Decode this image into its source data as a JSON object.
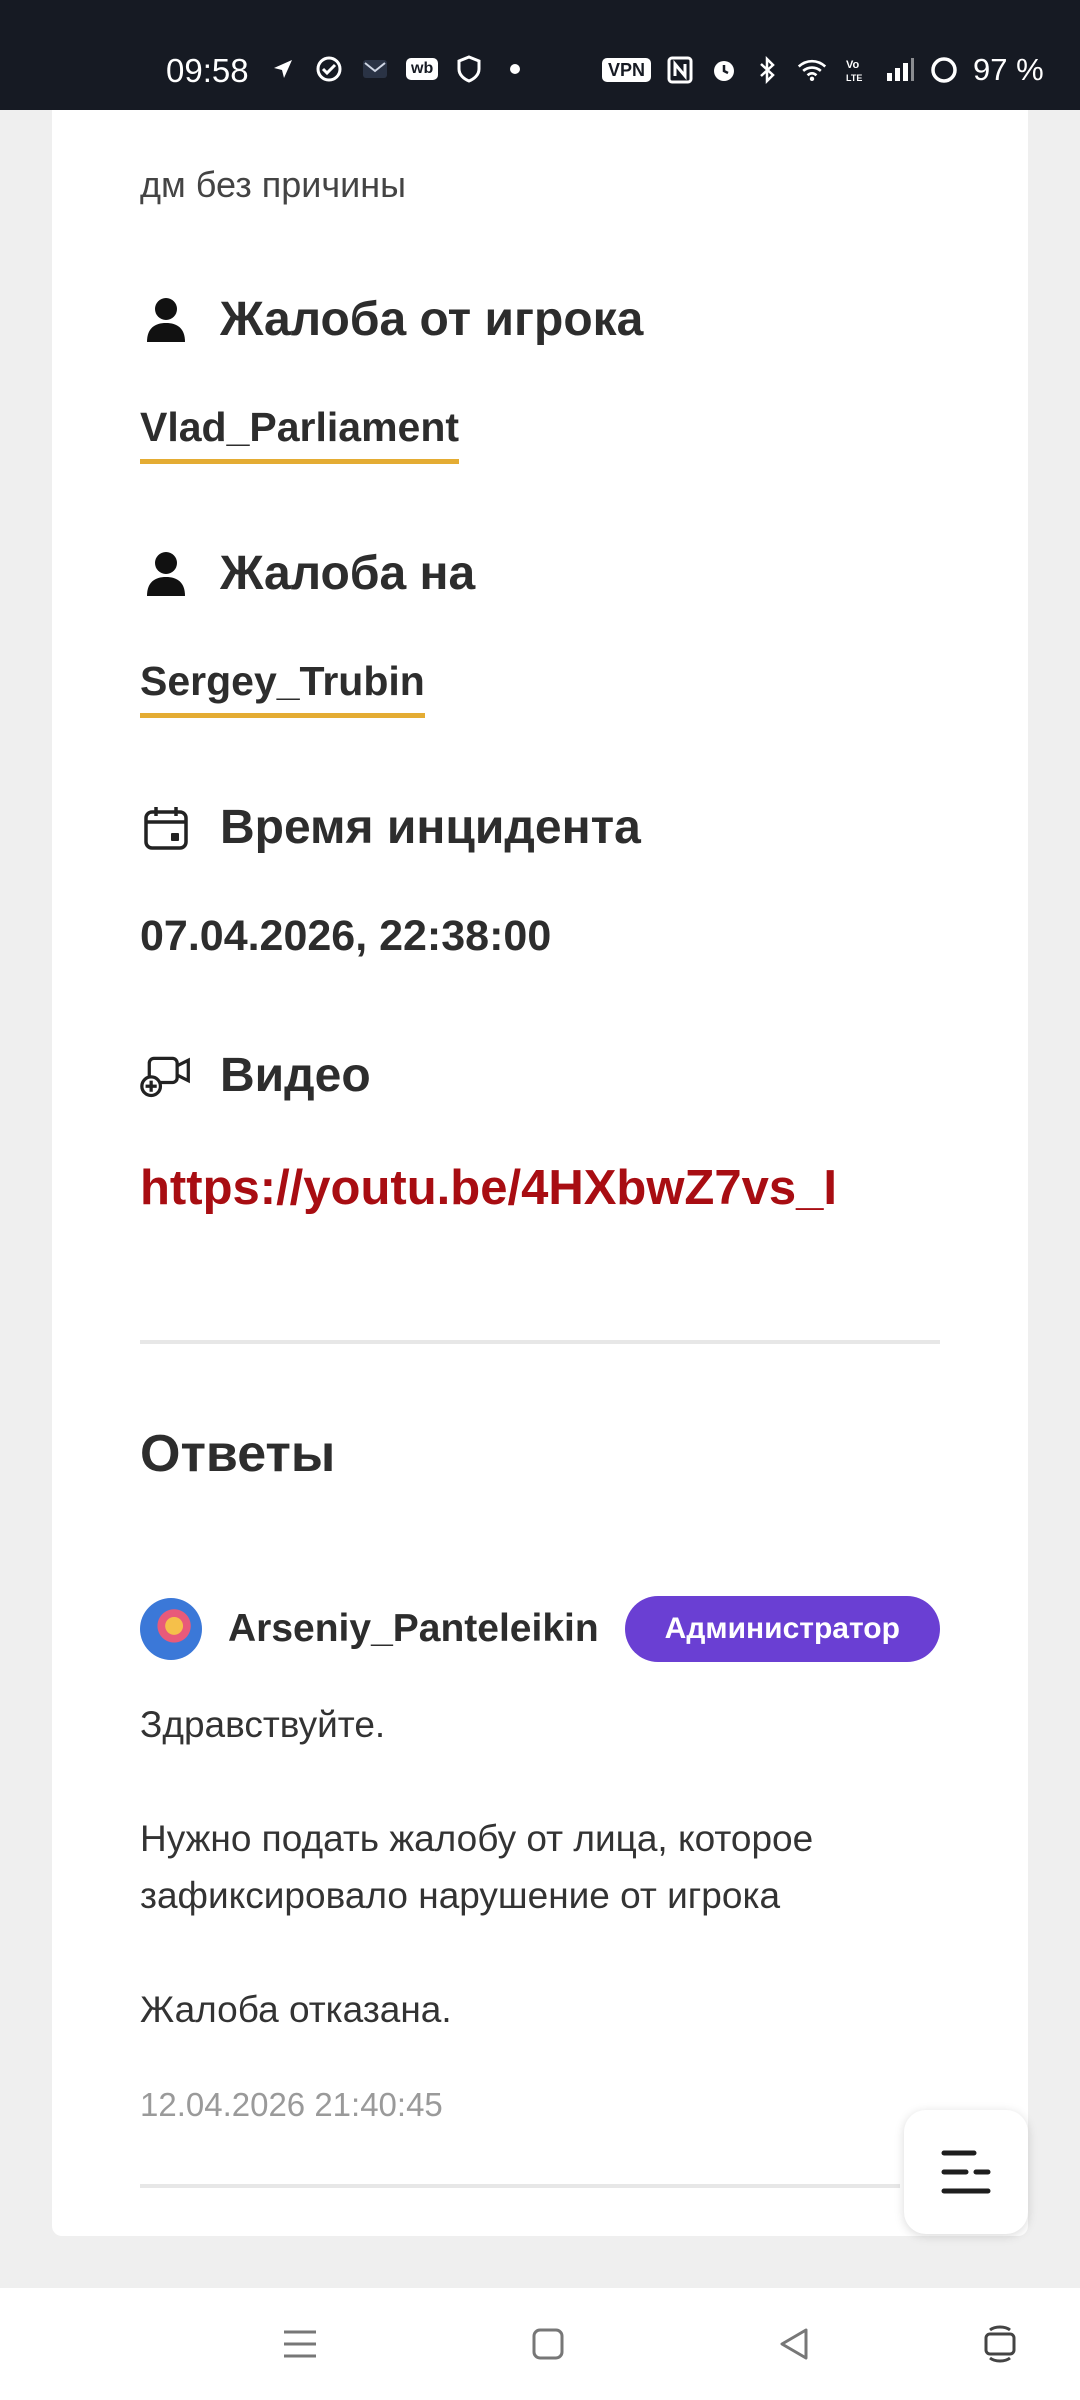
{
  "status_bar": {
    "time": "09:58",
    "vpn_label": "VPN",
    "wb_label": "wb",
    "battery_text": "97 %",
    "icons": [
      "location-arrow-icon",
      "check-circle-icon",
      "mail-icon",
      "wb-app-icon",
      "shield-icon",
      "dot-icon",
      "vpn-icon",
      "nfc-icon",
      "alarm-icon",
      "bluetooth-icon",
      "wifi-icon",
      "volte-icon",
      "signal-icon",
      "battery-icon"
    ]
  },
  "complaint": {
    "reason_text": "дм без причины",
    "from_heading": "Жалоба от игрока",
    "from_player": "Vlad_Parliament",
    "against_heading": "Жалоба на",
    "against_player": "Sergey_Trubin",
    "time_heading": "Время инцидента",
    "incident_time": "07.04.2026, 22:38:00",
    "video_heading": "Видео",
    "video_link": "https://youtu.be/4HXbwZ7vs_I"
  },
  "answers": {
    "title": "Ответы",
    "reply": {
      "author": "Arseniy_Panteleikin",
      "role": "Администратор",
      "paragraphs": [
        "Здравствуйте.",
        "Нужно подать жалобу от лица, которое зафиксировало нарушение от игрока",
        "Жалоба отказана."
      ],
      "timestamp": "12.04.2026 21:40:45"
    }
  },
  "colors": {
    "accent_underline": "#e4ac33",
    "link_red": "#a80d12",
    "admin_badge": "#6a3fd3",
    "status_bar_bg": "#161a23"
  },
  "nav_bar": {
    "icons": [
      "menu-icon",
      "home-square-icon",
      "back-triangle-icon",
      "rotate-icon"
    ]
  }
}
